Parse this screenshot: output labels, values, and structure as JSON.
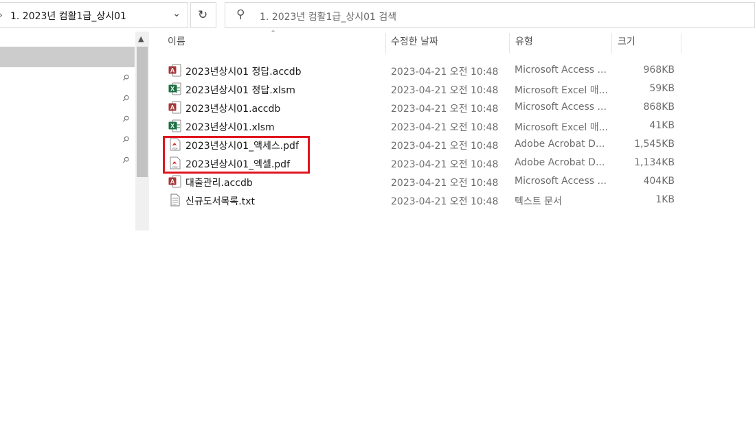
{
  "address_bar": {
    "path": "1. 2023년 컴활1급_상시01",
    "search_placeholder": "1. 2023년 컴활1급_상시01 검색"
  },
  "columns": {
    "name": "이름",
    "date": "수정한 날짜",
    "type": "유형",
    "size": "크기"
  },
  "files": [
    {
      "icon": "access-file-icon",
      "name": "2023년상시01 정답.accdb",
      "date": "2023-04-21 오전 10:48",
      "type": "Microsoft Access ...",
      "size": "968KB"
    },
    {
      "icon": "excel-file-icon",
      "name": "2023년상시01 정답.xlsm",
      "date": "2023-04-21 오전 10:48",
      "type": "Microsoft Excel 매...",
      "size": "59KB"
    },
    {
      "icon": "access-file-icon",
      "name": "2023년상시01.accdb",
      "date": "2023-04-21 오전 10:48",
      "type": "Microsoft Access ...",
      "size": "868KB"
    },
    {
      "icon": "excel-file-icon",
      "name": "2023년상시01.xlsm",
      "date": "2023-04-21 오전 10:48",
      "type": "Microsoft Excel 매...",
      "size": "41KB"
    },
    {
      "icon": "pdf-file-icon",
      "name": "2023년상시01_액세스.pdf",
      "date": "2023-04-21 오전 10:48",
      "type": "Adobe Acrobat D...",
      "size": "1,545KB"
    },
    {
      "icon": "pdf-file-icon",
      "name": "2023년상시01_엑셀.pdf",
      "date": "2023-04-21 오전 10:48",
      "type": "Adobe Acrobat D...",
      "size": "1,134KB"
    },
    {
      "icon": "access-file-icon",
      "name": "대출관리.accdb",
      "date": "2023-04-21 오전 10:48",
      "type": "Microsoft Access ...",
      "size": "404KB"
    },
    {
      "icon": "text-file-icon",
      "name": "신규도서목록.txt",
      "date": "2023-04-21 오전 10:48",
      "type": "텍스트 문서",
      "size": "1KB"
    }
  ],
  "colors": {
    "highlight": "#e0141e",
    "access": "#a4373a",
    "excel": "#1d6f42",
    "pdf": "#d9251c"
  }
}
